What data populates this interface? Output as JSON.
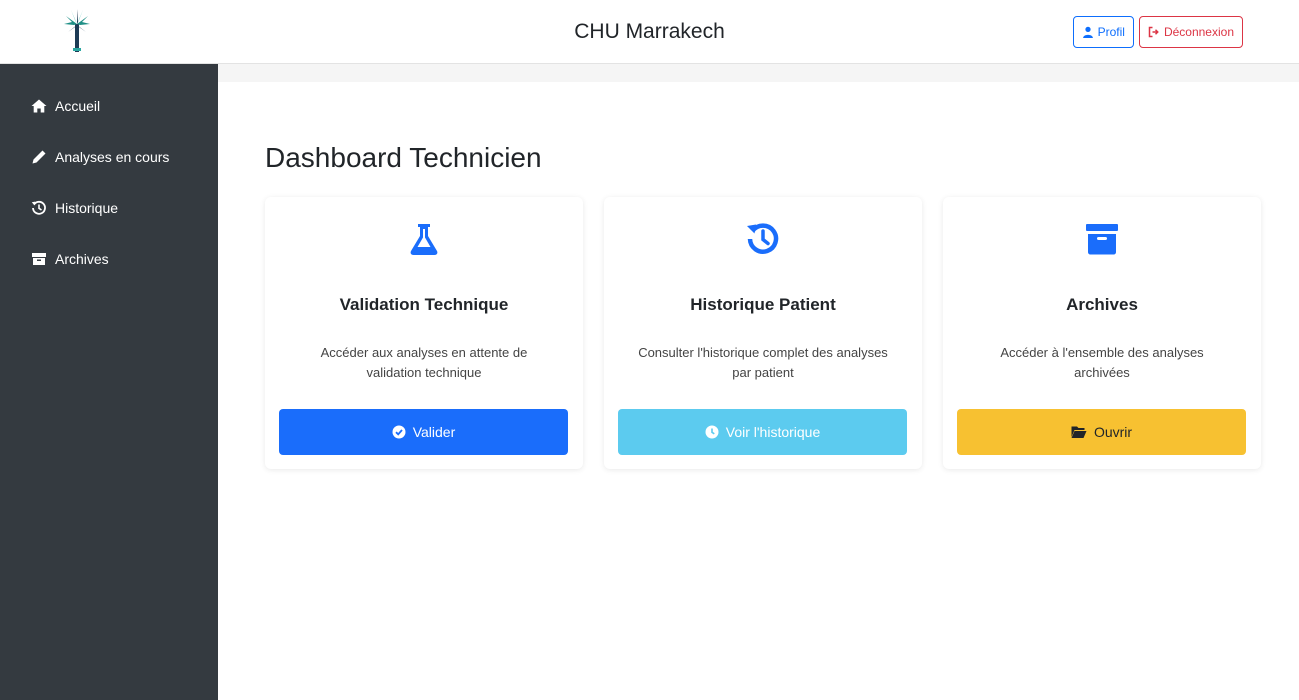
{
  "header": {
    "title": "CHU Marrakech",
    "logo_icon": "palm-tree-logo",
    "profile_label": "Profil",
    "logout_label": "Déconnexion"
  },
  "sidebar": {
    "items": [
      {
        "label": "Accueil",
        "icon": "home-icon"
      },
      {
        "label": "Analyses en cours",
        "icon": "pencil-icon"
      },
      {
        "label": "Historique",
        "icon": "history-icon"
      },
      {
        "label": "Archives",
        "icon": "archive-icon"
      }
    ]
  },
  "main": {
    "title": "Dashboard Technicien",
    "cards": [
      {
        "icon": "flask-icon",
        "title": "Validation Technique",
        "description": "Accéder aux analyses en attente de validation technique",
        "button_label": "Valider",
        "button_icon": "check-circle-icon",
        "button_color": "#1a6dfb"
      },
      {
        "icon": "history-icon",
        "title": "Historique Patient",
        "description": "Consulter l'historique complet des analyses par patient",
        "button_label": "Voir l'historique",
        "button_icon": "clock-icon",
        "button_color": "#5ccbef"
      },
      {
        "icon": "archive-icon",
        "title": "Archives",
        "description": "Accéder à l'ensemble des analyses archivées",
        "button_label": "Ouvrir",
        "button_icon": "folder-open-icon",
        "button_color": "#f7c131"
      }
    ]
  },
  "colors": {
    "primary": "#1a6dfb",
    "info": "#5ccbef",
    "warning": "#f7c131",
    "danger": "#dc3545",
    "sidebar_bg": "#343a40"
  }
}
